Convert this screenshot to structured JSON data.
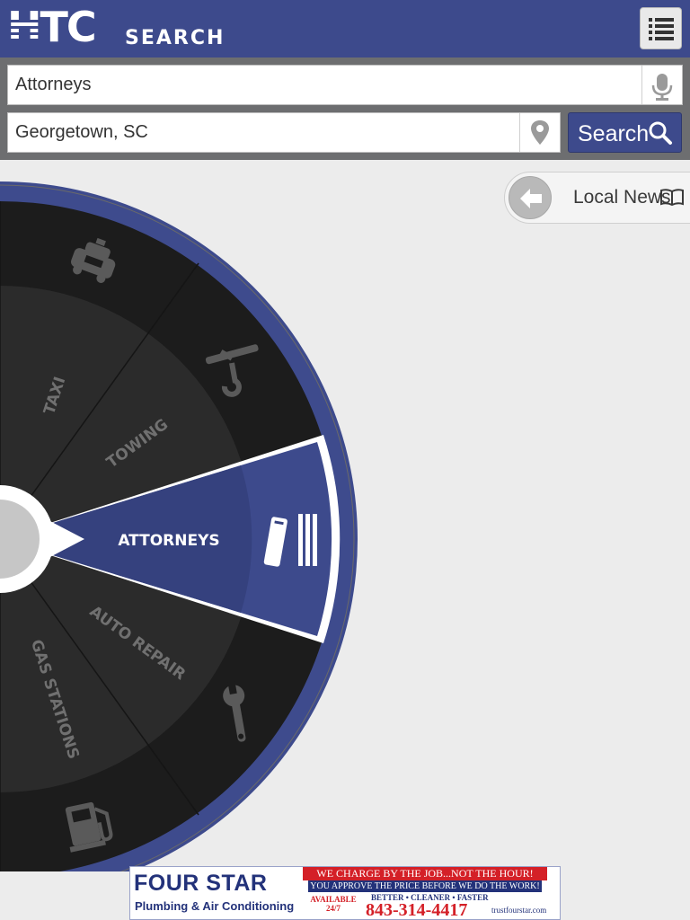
{
  "header": {
    "logo_text": "HTC",
    "logo_subtext": "SEARCH",
    "menu_icon": "list-icon"
  },
  "search": {
    "what_value": "Attorneys",
    "where_value": "Georgetown, SC",
    "button_label": "Search",
    "mic_icon": "microphone-icon",
    "pin_icon": "location-pin-icon",
    "search_icon": "magnifier-icon"
  },
  "local_news": {
    "label": "Local News",
    "back_icon": "arrow-left-icon",
    "book_icon": "open-book-icon"
  },
  "wheel": {
    "selected": "ATTORNEYS",
    "categories": [
      {
        "label": "TAXI",
        "icon": "taxi-icon"
      },
      {
        "label": "TOWING",
        "icon": "tow-hook-icon"
      },
      {
        "label": "ATTORNEYS",
        "icon": "law-books-icon"
      },
      {
        "label": "AUTO REPAIR",
        "icon": "wrench-icon"
      },
      {
        "label": "GAS STATIONS",
        "icon": "gas-pump-icon"
      }
    ],
    "colors": {
      "accent": "#3d4a8c",
      "selected_inner": "#35417e",
      "ring": "#3e4b8d",
      "outer_dark": "#1c1c1c",
      "inner_dark": "#2b2b2b"
    }
  },
  "ad": {
    "brand": "FOUR STAR",
    "sub": "Plumbing & Air Conditioning",
    "tagline": "WE CHARGE BY THE JOB...NOT THE HOUR!",
    "tagline2": "YOU APPROVE THE PRICE BEFORE WE DO THE WORK!",
    "available": "AVAILABLE 24/7",
    "better": "BETTER • CLEANER • FASTER",
    "phone": "843-314-4417",
    "web": "trustfourstar.com"
  }
}
